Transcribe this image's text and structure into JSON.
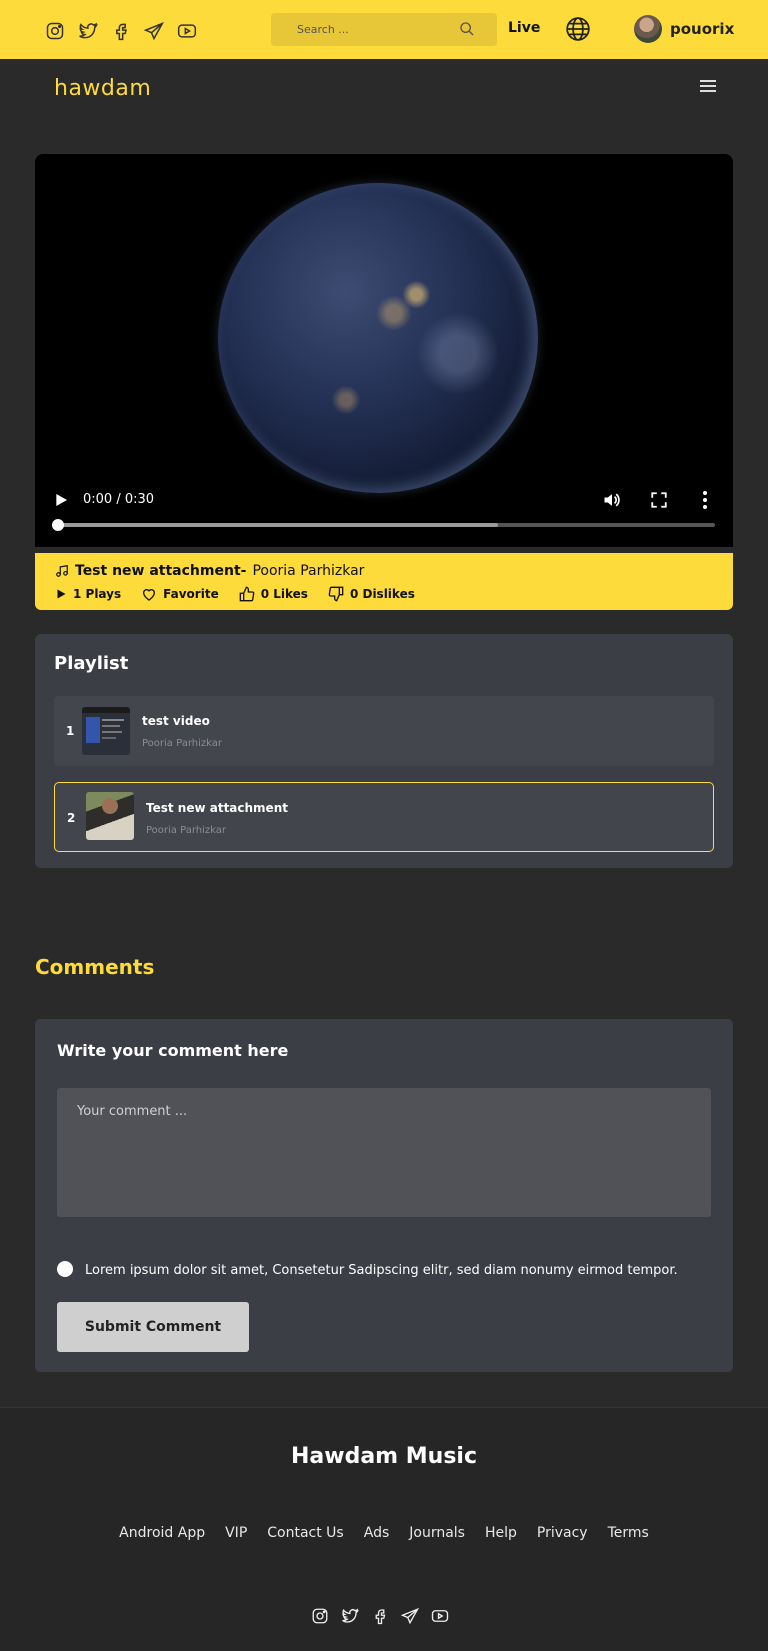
{
  "topbar": {
    "social_icons": [
      "instagram-icon",
      "twitter-icon",
      "facebook-icon",
      "telegram-icon",
      "youtube-icon"
    ],
    "search_placeholder": "Search ...",
    "live_label": "Live",
    "username": "pouorix"
  },
  "header": {
    "logo_text": "hawdam"
  },
  "player": {
    "time": "0:00 / 0:30",
    "progress": 0.0,
    "buffered": 0.67
  },
  "track": {
    "title": "Test new attachment-",
    "artist": "Pooria Parhizkar",
    "plays": "1 Plays",
    "favorite": "Favorite",
    "likes": "0 Likes",
    "dislikes": "0 Dislikes"
  },
  "playlist": {
    "heading": "Playlist",
    "items": [
      {
        "num": "1",
        "title": "test video",
        "artist": "Pooria Parhizkar"
      },
      {
        "num": "2",
        "title": "Test new attachment",
        "artist": "Pooria Parhizkar"
      }
    ]
  },
  "comments": {
    "heading": "Comments",
    "form_heading": "Write your comment here",
    "placeholder": "Your comment ...",
    "terms_text": "Lorem ipsum dolor sit amet, Consetetur Sadipscing elitr, sed diam nonumy eirmod tempor.",
    "submit_label": "Submit Comment"
  },
  "footer": {
    "title": "Hawdam Music",
    "links": [
      "Android App",
      "VIP",
      "Contact Us",
      "Ads",
      "Journals",
      "Help",
      "Privacy",
      "Terms"
    ]
  },
  "colors": {
    "accent": "#fddb3a",
    "background": "#2a2a2a",
    "card": "#3c3e45"
  }
}
